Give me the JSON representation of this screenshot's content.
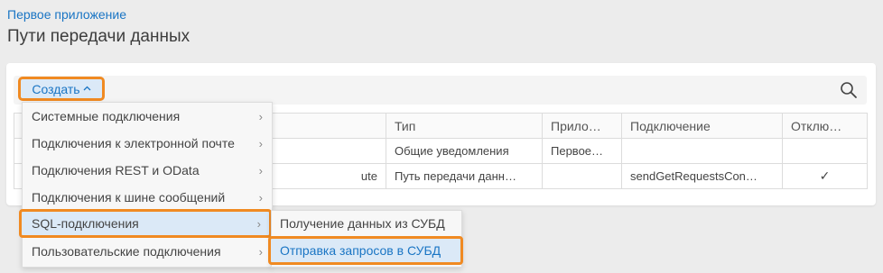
{
  "breadcrumb": "Первое приложение",
  "page_title": "Пути передачи данных",
  "toolbar": {
    "create_label": "Создать",
    "create_chevron": "^",
    "search_icon": "search-icon"
  },
  "table": {
    "headers": [
      "",
      "Тип",
      "Прило…",
      "Подключение",
      "Отклю…"
    ],
    "rows": [
      {
        "name": "",
        "type": "Общие уведомления",
        "app": "Первое…",
        "connection": "",
        "disabled": ""
      },
      {
        "name": "ute",
        "type": "Путь передачи данн…",
        "app": "",
        "connection": "sendGetRequestsCon…",
        "disabled": "✓"
      }
    ]
  },
  "menu": {
    "items": [
      {
        "label": "Системные подключения"
      },
      {
        "label": "Подключения к электронной почте"
      },
      {
        "label": "Подключения REST и OData"
      },
      {
        "label": "Подключения к шине сообщений"
      },
      {
        "label": "SQL-подключения"
      },
      {
        "label": "Пользовательские подключения"
      }
    ],
    "arrow": "›"
  },
  "submenu": {
    "items": [
      {
        "label": "Получение данных из СУБД"
      },
      {
        "label": "Отправка запросов в СУБД"
      }
    ]
  },
  "colors": {
    "accent": "#1a75c4",
    "highlight_border": "#f08a22",
    "highlight_fill": "#dbe9f7"
  }
}
